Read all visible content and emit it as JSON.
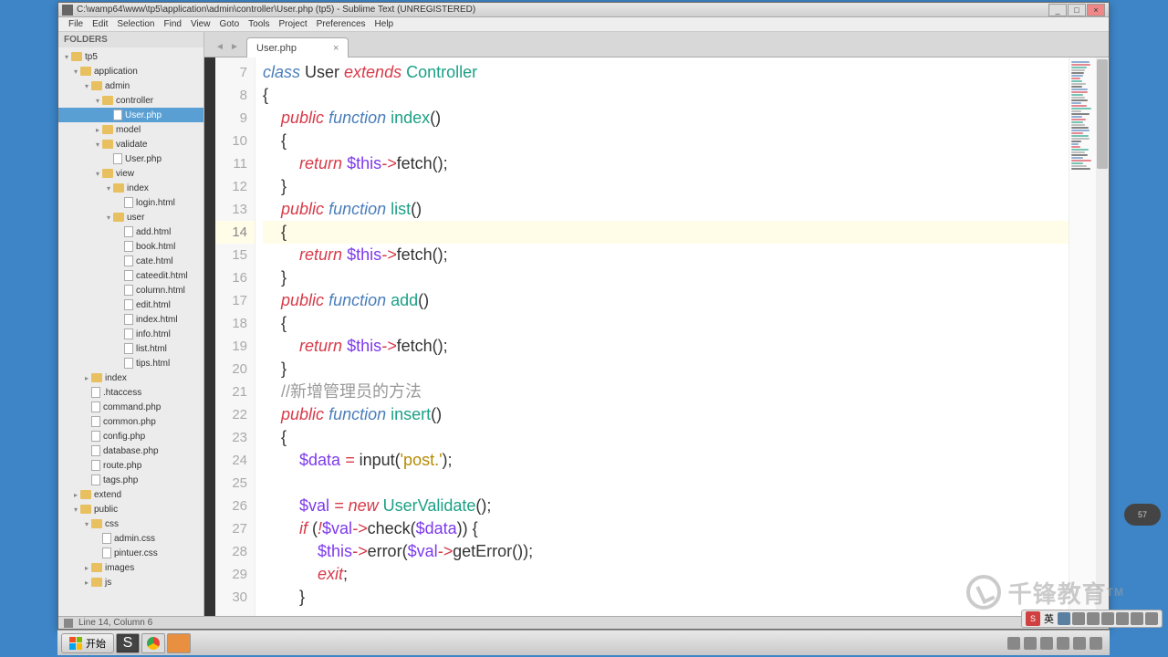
{
  "title": "C:\\wamp64\\www\\tp5\\application\\admin\\controller\\User.php (tp5) - Sublime Text (UNREGISTERED)",
  "menu": [
    "File",
    "Edit",
    "Selection",
    "Find",
    "View",
    "Goto",
    "Tools",
    "Project",
    "Preferences",
    "Help"
  ],
  "sidebar": {
    "header": "FOLDERS",
    "tree": [
      {
        "l": 0,
        "t": "folder",
        "open": true,
        "name": "tp5"
      },
      {
        "l": 1,
        "t": "folder",
        "open": true,
        "name": "application"
      },
      {
        "l": 2,
        "t": "folder",
        "open": true,
        "name": "admin"
      },
      {
        "l": 3,
        "t": "folder",
        "open": true,
        "name": "controller"
      },
      {
        "l": 4,
        "t": "file",
        "name": "User.php",
        "selected": true
      },
      {
        "l": 3,
        "t": "folder",
        "open": false,
        "name": "model"
      },
      {
        "l": 3,
        "t": "folder",
        "open": true,
        "name": "validate"
      },
      {
        "l": 4,
        "t": "file",
        "name": "User.php"
      },
      {
        "l": 3,
        "t": "folder",
        "open": true,
        "name": "view"
      },
      {
        "l": 4,
        "t": "folder",
        "open": true,
        "name": "index"
      },
      {
        "l": 5,
        "t": "file",
        "name": "login.html"
      },
      {
        "l": 4,
        "t": "folder",
        "open": true,
        "name": "user"
      },
      {
        "l": 5,
        "t": "file",
        "name": "add.html"
      },
      {
        "l": 5,
        "t": "file",
        "name": "book.html"
      },
      {
        "l": 5,
        "t": "file",
        "name": "cate.html"
      },
      {
        "l": 5,
        "t": "file",
        "name": "cateedit.html"
      },
      {
        "l": 5,
        "t": "file",
        "name": "column.html"
      },
      {
        "l": 5,
        "t": "file",
        "name": "edit.html"
      },
      {
        "l": 5,
        "t": "file",
        "name": "index.html"
      },
      {
        "l": 5,
        "t": "file",
        "name": "info.html"
      },
      {
        "l": 5,
        "t": "file",
        "name": "list.html"
      },
      {
        "l": 5,
        "t": "file",
        "name": "tips.html"
      },
      {
        "l": 2,
        "t": "folder",
        "open": false,
        "name": "index"
      },
      {
        "l": 2,
        "t": "file",
        "name": ".htaccess"
      },
      {
        "l": 2,
        "t": "file",
        "name": "command.php"
      },
      {
        "l": 2,
        "t": "file",
        "name": "common.php"
      },
      {
        "l": 2,
        "t": "file",
        "name": "config.php"
      },
      {
        "l": 2,
        "t": "file",
        "name": "database.php"
      },
      {
        "l": 2,
        "t": "file",
        "name": "route.php"
      },
      {
        "l": 2,
        "t": "file",
        "name": "tags.php"
      },
      {
        "l": 1,
        "t": "folder",
        "open": false,
        "name": "extend"
      },
      {
        "l": 1,
        "t": "folder",
        "open": true,
        "name": "public"
      },
      {
        "l": 2,
        "t": "folder",
        "open": true,
        "name": "css"
      },
      {
        "l": 3,
        "t": "file",
        "name": "admin.css"
      },
      {
        "l": 3,
        "t": "file",
        "name": "pintuer.css"
      },
      {
        "l": 2,
        "t": "folder",
        "open": false,
        "name": "images"
      },
      {
        "l": 2,
        "t": "folder",
        "open": false,
        "name": "js"
      }
    ]
  },
  "tab": {
    "name": "User.php"
  },
  "code": {
    "start": 7,
    "current": 14,
    "lines": [
      [
        {
          "c": "k-blue",
          "t": "class"
        },
        {
          "t": " User "
        },
        {
          "c": "k-red",
          "t": "extends"
        },
        {
          "t": " "
        },
        {
          "c": "k-teal",
          "t": "Controller"
        }
      ],
      [
        {
          "t": "{"
        }
      ],
      [
        {
          "t": "    "
        },
        {
          "c": "k-red",
          "t": "public"
        },
        {
          "t": " "
        },
        {
          "c": "k-blue",
          "t": "function"
        },
        {
          "t": " "
        },
        {
          "c": "k-teal",
          "t": "index"
        },
        {
          "t": "()"
        }
      ],
      [
        {
          "t": "    {"
        }
      ],
      [
        {
          "t": "        "
        },
        {
          "c": "k-red",
          "t": "return"
        },
        {
          "t": " "
        },
        {
          "c": "k-purple",
          "t": "$this"
        },
        {
          "c": "k-red",
          "t": "->"
        },
        {
          "t": "fetch();"
        }
      ],
      [
        {
          "t": "    }"
        }
      ],
      [
        {
          "t": "    "
        },
        {
          "c": "k-red",
          "t": "public"
        },
        {
          "t": " "
        },
        {
          "c": "k-blue",
          "t": "function"
        },
        {
          "t": " "
        },
        {
          "c": "k-teal",
          "t": "list"
        },
        {
          "t": "()"
        }
      ],
      [
        {
          "t": "    {"
        }
      ],
      [
        {
          "t": "        "
        },
        {
          "c": "k-red",
          "t": "return"
        },
        {
          "t": " "
        },
        {
          "c": "k-purple",
          "t": "$this"
        },
        {
          "c": "k-red",
          "t": "->"
        },
        {
          "t": "fetch();"
        }
      ],
      [
        {
          "t": "    }"
        }
      ],
      [
        {
          "t": "    "
        },
        {
          "c": "k-red",
          "t": "public"
        },
        {
          "t": " "
        },
        {
          "c": "k-blue",
          "t": "function"
        },
        {
          "t": " "
        },
        {
          "c": "k-teal",
          "t": "add"
        },
        {
          "t": "()"
        }
      ],
      [
        {
          "t": "    {"
        }
      ],
      [
        {
          "t": "        "
        },
        {
          "c": "k-red",
          "t": "return"
        },
        {
          "t": " "
        },
        {
          "c": "k-purple",
          "t": "$this"
        },
        {
          "c": "k-red",
          "t": "->"
        },
        {
          "t": "fetch();"
        }
      ],
      [
        {
          "t": "    }"
        }
      ],
      [
        {
          "t": "    "
        },
        {
          "c": "k-gray",
          "t": "//新增管理员的方法"
        }
      ],
      [
        {
          "t": "    "
        },
        {
          "c": "k-red",
          "t": "public"
        },
        {
          "t": " "
        },
        {
          "c": "k-blue",
          "t": "function"
        },
        {
          "t": " "
        },
        {
          "c": "k-teal",
          "t": "insert"
        },
        {
          "t": "()"
        }
      ],
      [
        {
          "t": "    {"
        }
      ],
      [
        {
          "t": "        "
        },
        {
          "c": "k-purple",
          "t": "$data"
        },
        {
          "t": " "
        },
        {
          "c": "k-red",
          "t": "="
        },
        {
          "t": " input("
        },
        {
          "c": "k-gold",
          "t": "'post.'"
        },
        {
          "t": ");"
        }
      ],
      [
        {
          "t": ""
        }
      ],
      [
        {
          "t": "        "
        },
        {
          "c": "k-purple",
          "t": "$val"
        },
        {
          "t": " "
        },
        {
          "c": "k-red",
          "t": "="
        },
        {
          "t": " "
        },
        {
          "c": "k-red",
          "t": "new"
        },
        {
          "t": " "
        },
        {
          "c": "k-teal",
          "t": "UserValidate"
        },
        {
          "t": "();"
        }
      ],
      [
        {
          "t": "        "
        },
        {
          "c": "k-red",
          "t": "if"
        },
        {
          "t": " ("
        },
        {
          "c": "k-red",
          "t": "!"
        },
        {
          "c": "k-purple",
          "t": "$val"
        },
        {
          "c": "k-red",
          "t": "->"
        },
        {
          "t": "check("
        },
        {
          "c": "k-purple",
          "t": "$data"
        },
        {
          "t": ")) {"
        }
      ],
      [
        {
          "t": "            "
        },
        {
          "c": "k-purple",
          "t": "$this"
        },
        {
          "c": "k-red",
          "t": "->"
        },
        {
          "t": "error("
        },
        {
          "c": "k-purple",
          "t": "$val"
        },
        {
          "c": "k-red",
          "t": "->"
        },
        {
          "t": "getError());"
        }
      ],
      [
        {
          "t": "            "
        },
        {
          "c": "k-red",
          "t": "exit"
        },
        {
          "t": ";"
        }
      ],
      [
        {
          "t": "        }"
        }
      ]
    ]
  },
  "status": "Line 14, Column 6",
  "start_label": "开始",
  "ime_lang": "英",
  "watermark": "千锋教育",
  "badge": "57"
}
